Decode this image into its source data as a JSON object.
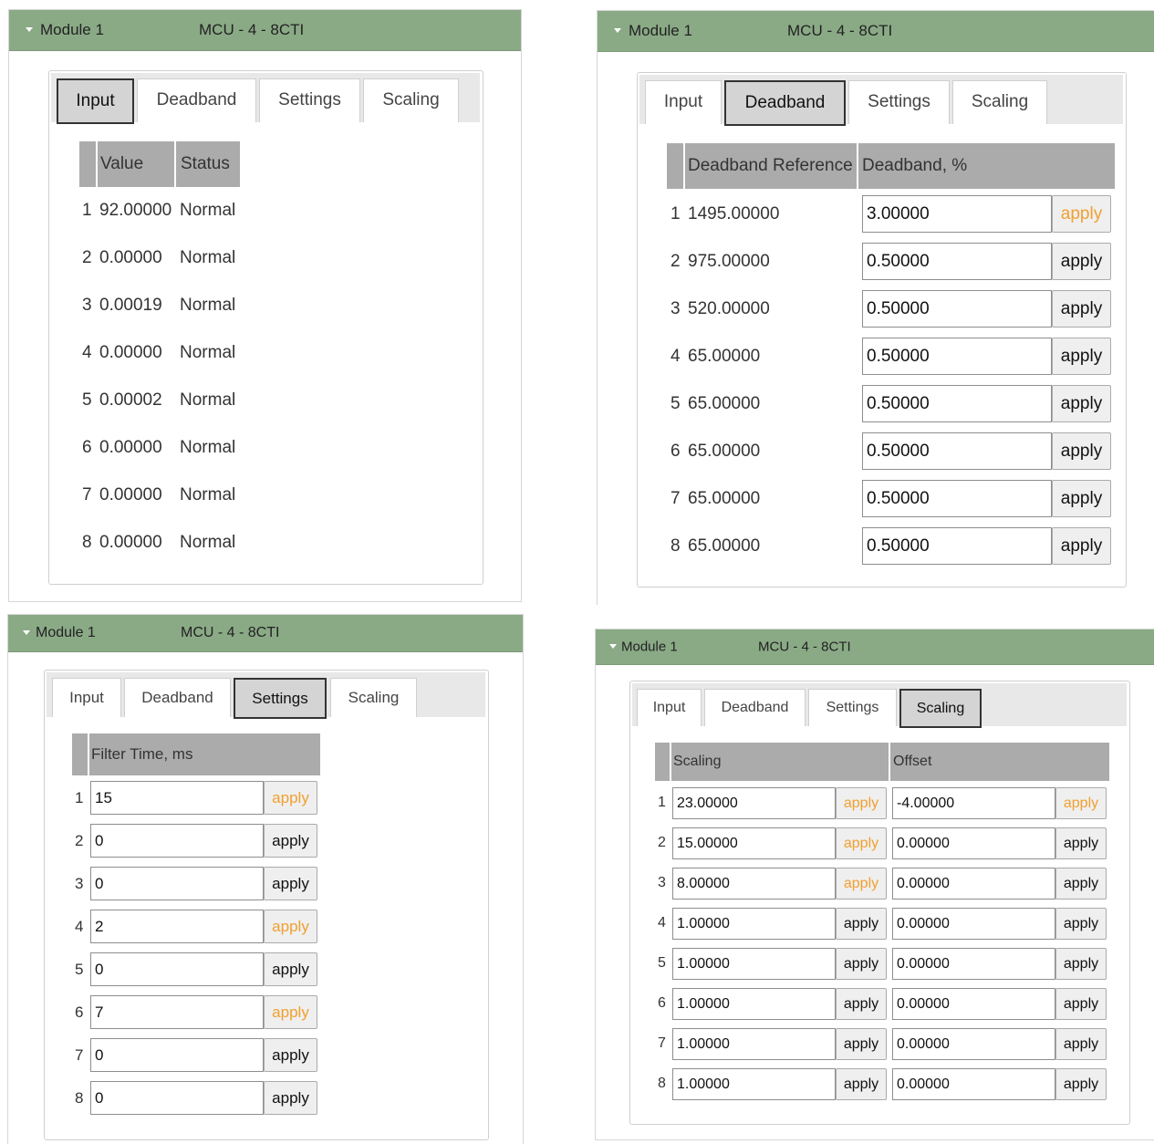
{
  "tabs": [
    "Input",
    "Deadband",
    "Settings",
    "Scaling"
  ],
  "colors": {
    "header_bg": "#8aaa86",
    "active_tab_bg": "#d4d4d4",
    "table_head_bg": "#ababab",
    "pending_apply_text": "#f0a030"
  },
  "icons": {
    "collapse": "caret-down-icon"
  },
  "panels": [
    {
      "module": "Module 1",
      "device": "MCU - 4 - 8CTI",
      "active_tab": "Input",
      "headers": {
        "value": "Value",
        "status": "Status"
      },
      "rows": [
        {
          "n": "1",
          "value": "92.00000",
          "status": "Normal"
        },
        {
          "n": "2",
          "value": "0.00000",
          "status": "Normal"
        },
        {
          "n": "3",
          "value": "0.00019",
          "status": "Normal"
        },
        {
          "n": "4",
          "value": "0.00000",
          "status": "Normal"
        },
        {
          "n": "5",
          "value": "0.00002",
          "status": "Normal"
        },
        {
          "n": "6",
          "value": "0.00000",
          "status": "Normal"
        },
        {
          "n": "7",
          "value": "0.00000",
          "status": "Normal"
        },
        {
          "n": "8",
          "value": "0.00000",
          "status": "Normal"
        }
      ]
    },
    {
      "module": "Module 1",
      "device": "MCU - 4 - 8CTI",
      "active_tab": "Deadband",
      "headers": {
        "reference": "Deadband Reference",
        "deadband": "Deadband, %"
      },
      "rows": [
        {
          "n": "1",
          "reference": "1495.00000",
          "deadband": "3.00000",
          "apply": "apply",
          "pending": true
        },
        {
          "n": "2",
          "reference": "975.00000",
          "deadband": "0.50000",
          "apply": "apply",
          "pending": false
        },
        {
          "n": "3",
          "reference": "520.00000",
          "deadband": "0.50000",
          "apply": "apply",
          "pending": false
        },
        {
          "n": "4",
          "reference": "65.00000",
          "deadband": "0.50000",
          "apply": "apply",
          "pending": false
        },
        {
          "n": "5",
          "reference": "65.00000",
          "deadband": "0.50000",
          "apply": "apply",
          "pending": false
        },
        {
          "n": "6",
          "reference": "65.00000",
          "deadband": "0.50000",
          "apply": "apply",
          "pending": false
        },
        {
          "n": "7",
          "reference": "65.00000",
          "deadband": "0.50000",
          "apply": "apply",
          "pending": false
        },
        {
          "n": "8",
          "reference": "65.00000",
          "deadband": "0.50000",
          "apply": "apply",
          "pending": false
        }
      ]
    },
    {
      "module": "Module 1",
      "device": "MCU - 4 - 8CTI",
      "active_tab": "Settings",
      "headers": {
        "filter": "Filter Time, ms"
      },
      "rows": [
        {
          "n": "1",
          "filter": "15",
          "apply": "apply",
          "pending": true
        },
        {
          "n": "2",
          "filter": "0",
          "apply": "apply",
          "pending": false
        },
        {
          "n": "3",
          "filter": "0",
          "apply": "apply",
          "pending": false
        },
        {
          "n": "4",
          "filter": "2",
          "apply": "apply",
          "pending": true
        },
        {
          "n": "5",
          "filter": "0",
          "apply": "apply",
          "pending": false
        },
        {
          "n": "6",
          "filter": "7",
          "apply": "apply",
          "pending": true
        },
        {
          "n": "7",
          "filter": "0",
          "apply": "apply",
          "pending": false
        },
        {
          "n": "8",
          "filter": "0",
          "apply": "apply",
          "pending": false
        }
      ]
    },
    {
      "module": "Module 1",
      "device": "MCU - 4 - 8CTI",
      "active_tab": "Scaling",
      "headers": {
        "scaling": "Scaling",
        "offset": "Offset"
      },
      "rows": [
        {
          "n": "1",
          "scaling": "23.00000",
          "scaling_pending": true,
          "offset": "-4.00000",
          "offset_pending": true,
          "apply": "apply"
        },
        {
          "n": "2",
          "scaling": "15.00000",
          "scaling_pending": true,
          "offset": "0.00000",
          "offset_pending": false,
          "apply": "apply"
        },
        {
          "n": "3",
          "scaling": "8.00000",
          "scaling_pending": true,
          "offset": "0.00000",
          "offset_pending": false,
          "apply": "apply"
        },
        {
          "n": "4",
          "scaling": "1.00000",
          "scaling_pending": false,
          "offset": "0.00000",
          "offset_pending": false,
          "apply": "apply"
        },
        {
          "n": "5",
          "scaling": "1.00000",
          "scaling_pending": false,
          "offset": "0.00000",
          "offset_pending": false,
          "apply": "apply"
        },
        {
          "n": "6",
          "scaling": "1.00000",
          "scaling_pending": false,
          "offset": "0.00000",
          "offset_pending": false,
          "apply": "apply"
        },
        {
          "n": "7",
          "scaling": "1.00000",
          "scaling_pending": false,
          "offset": "0.00000",
          "offset_pending": false,
          "apply": "apply"
        },
        {
          "n": "8",
          "scaling": "1.00000",
          "scaling_pending": false,
          "offset": "0.00000",
          "offset_pending": false,
          "apply": "apply"
        }
      ]
    }
  ]
}
